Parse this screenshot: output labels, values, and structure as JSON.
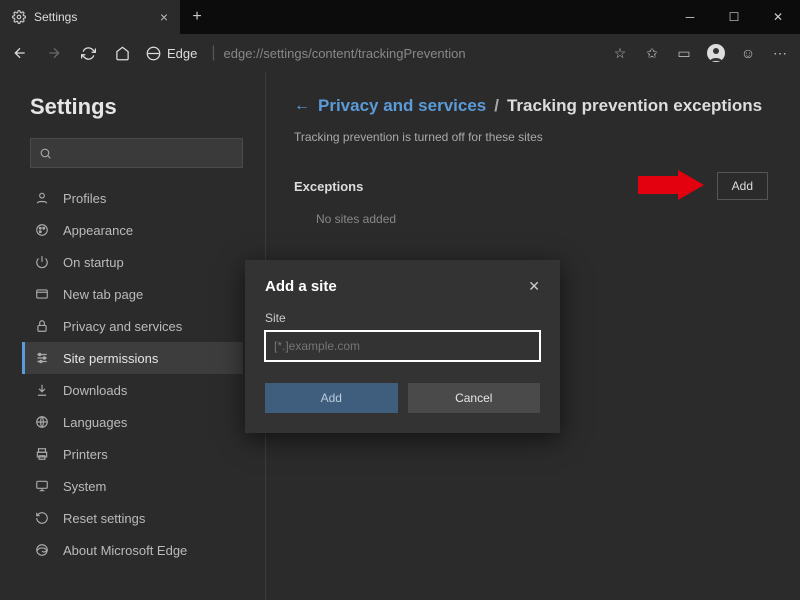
{
  "titlebar": {
    "tab_label": "Settings",
    "tab_icon": "gear-icon"
  },
  "addrbar": {
    "brand": "Edge",
    "url": "edge://settings/content/trackingPrevention"
  },
  "sidebar": {
    "heading": "Settings",
    "search_placeholder": "",
    "items": [
      {
        "icon": "person",
        "label": "Profiles"
      },
      {
        "icon": "brush",
        "label": "Appearance"
      },
      {
        "icon": "power",
        "label": "On startup"
      },
      {
        "icon": "tab",
        "label": "New tab page"
      },
      {
        "icon": "lock",
        "label": "Privacy and services"
      },
      {
        "icon": "sliders",
        "label": "Site permissions"
      },
      {
        "icon": "download",
        "label": "Downloads"
      },
      {
        "icon": "globe",
        "label": "Languages"
      },
      {
        "icon": "printer",
        "label": "Printers"
      },
      {
        "icon": "system",
        "label": "System"
      },
      {
        "icon": "reset",
        "label": "Reset settings"
      },
      {
        "icon": "edge",
        "label": "About Microsoft Edge"
      }
    ],
    "selected_index": 5
  },
  "main": {
    "breadcrumb_link": "Privacy and services",
    "breadcrumb_sep": "/",
    "breadcrumb_current": "Tracking prevention exceptions",
    "subtitle": "Tracking prevention is turned off for these sites",
    "section_title": "Exceptions",
    "add_button": "Add",
    "empty_text": "No sites added"
  },
  "dialog": {
    "title": "Add a site",
    "field_label": "Site",
    "placeholder": "[*.]example.com",
    "add": "Add",
    "cancel": "Cancel"
  }
}
